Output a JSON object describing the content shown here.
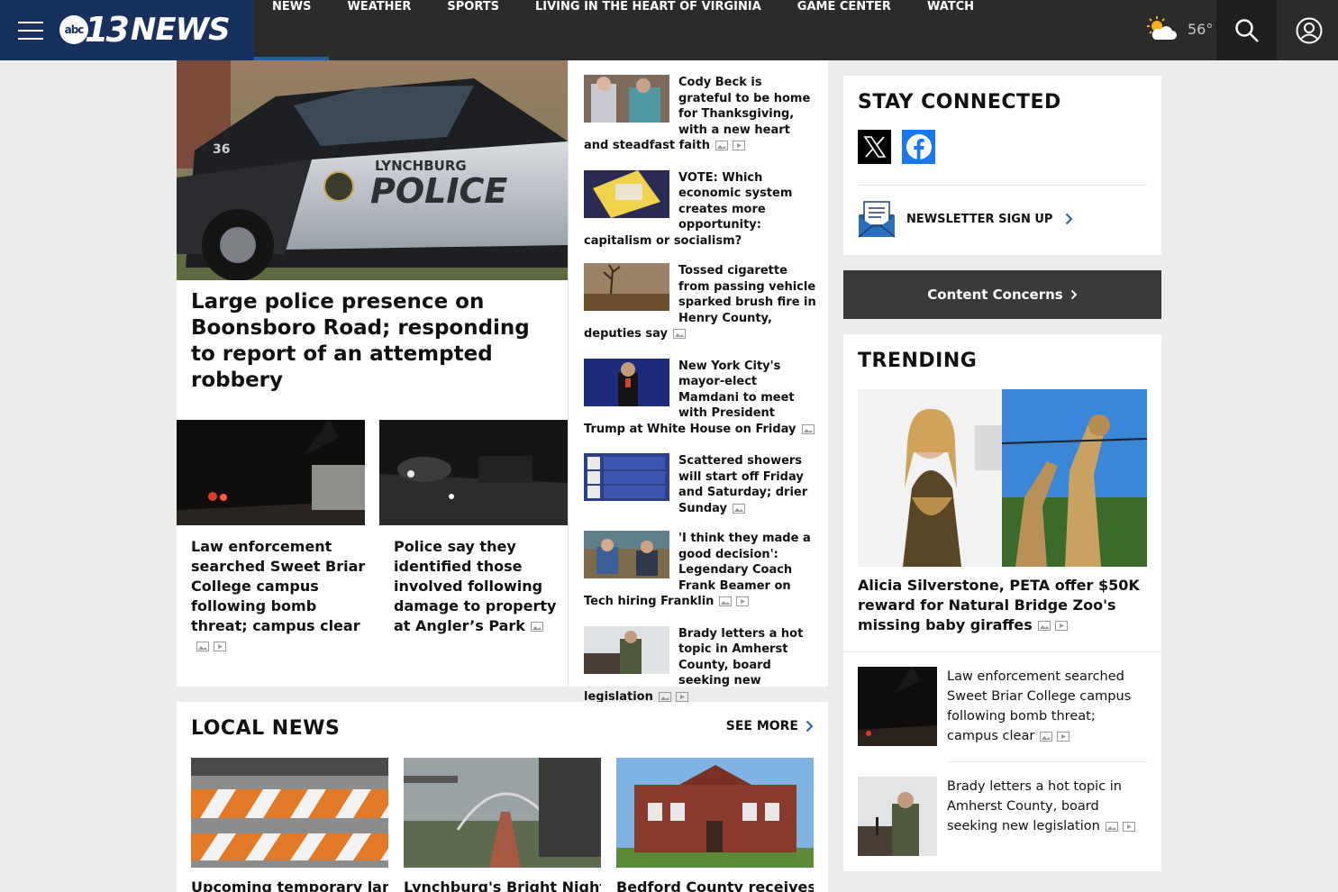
{
  "header": {
    "logo": {
      "abc": "abc",
      "number": "13",
      "word": "NEWS"
    },
    "nav": [
      "NEWS",
      "WEATHER",
      "SPORTS",
      "LIVING IN THE HEART OF VIRGINIA",
      "GAME CENTER",
      "WATCH"
    ],
    "active_nav": "NEWS",
    "weather": {
      "icon": "partly-cloudy-sun-icon",
      "temp": "56°"
    }
  },
  "lead": {
    "title": "Large police presence on Boonsboro Road; responding to report of an attempted robbery",
    "image_text": {
      "line1": "LYNCHBURG",
      "line2": "POLICE",
      "unit": "36"
    },
    "sub_stories": [
      {
        "title": "Law enforcement searched Sweet Briar College campus following bomb threat; campus clear",
        "media": [
          "gallery",
          "video"
        ]
      },
      {
        "title": "Police say they identified those involved following damage to property at Angler’s Park",
        "media": [
          "gallery"
        ]
      }
    ]
  },
  "side_stories": [
    {
      "title": "Cody Beck is grateful to be home for Thanksgiving, with a new heart and steadfast faith",
      "media": [
        "gallery",
        "video"
      ]
    },
    {
      "title": "VOTE: Which economic system creates more opportunity: capitalism or socialism?",
      "media": []
    },
    {
      "title": "Tossed cigarette from passing vehicle sparked brush fire in Henry County, deputies say",
      "media": [
        "gallery"
      ]
    },
    {
      "title": "New York City's mayor-elect Mamdani to meet with President Trump at White House on Friday",
      "media": [
        "gallery"
      ]
    },
    {
      "title": "Scattered showers will start off Friday and Saturday; drier Sunday",
      "media": [
        "gallery"
      ]
    },
    {
      "title": "'I think they made a good decision': Legendary Coach Frank Beamer on Tech hiring Franklin",
      "media": [
        "gallery",
        "video"
      ]
    },
    {
      "title": "Brady letters a hot topic in Amherst County, board seeking new legislation",
      "media": [
        "gallery",
        "video"
      ]
    }
  ],
  "local_news": {
    "heading": "LOCAL NEWS",
    "see_more": "SEE MORE",
    "items": [
      {
        "title": "Upcoming temporary lane"
      },
      {
        "title": "Lynchburg's Bright Nights"
      },
      {
        "title": "Bedford County receives"
      }
    ]
  },
  "rail": {
    "stay_connected": "STAY CONNECTED",
    "social": [
      "x-icon",
      "facebook-icon"
    ],
    "newsletter": "NEWSLETTER SIGN UP",
    "content_concerns": "Content Concerns",
    "trending_heading": "TRENDING",
    "trending_hero": {
      "title": "Alicia Silverstone, PETA offer $50K reward for Natural Bridge Zoo's missing baby giraffes",
      "media": [
        "gallery",
        "video"
      ]
    },
    "trending_items": [
      {
        "title": "Law enforcement searched Sweet Briar College campus following bomb threat; campus clear",
        "media": [
          "gallery",
          "video"
        ]
      },
      {
        "title": "Brady letters a hot topic in Amherst County, board seeking new legislation",
        "media": [
          "gallery",
          "video"
        ]
      }
    ]
  },
  "colors": {
    "brand_navy": "#17305e",
    "nav_bg": "#2b2b2b",
    "accent_blue": "#1f5fa8",
    "page_bg": "#ececec"
  }
}
